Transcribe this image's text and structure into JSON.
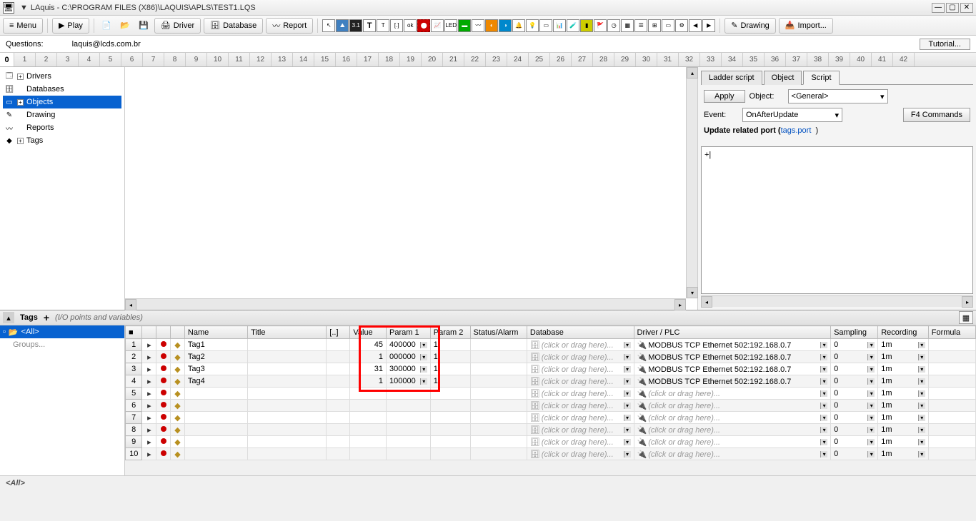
{
  "titlebar": {
    "app": "LAquis",
    "path": "C:\\PROGRAM FILES (X86)\\LAQUIS\\APLS\\TEST1.LQS"
  },
  "toolbar": {
    "menu": "Menu",
    "play": "Play",
    "driver": "Driver",
    "database": "Database",
    "report": "Report",
    "drawing": "Drawing",
    "import": "Import..."
  },
  "questions": {
    "label": "Questions:",
    "email": "laquis@lcds.com.br",
    "tutorial": "Tutorial..."
  },
  "ruler_start": "0",
  "tree": {
    "items": [
      "Drivers",
      "Databases",
      "Objects",
      "Drawing",
      "Reports",
      "Tags"
    ],
    "selected": "Objects"
  },
  "script_panel": {
    "tabs": [
      "Ladder script",
      "Object",
      "Script"
    ],
    "active_tab": "Script",
    "apply": "Apply",
    "object_label": "Object:",
    "object_value": "<General>",
    "event_label": "Event:",
    "event_value": "OnAfterUpdate",
    "f4": "F4 Commands",
    "update_text": "Update related port (",
    "tags_port": "tags.port",
    "close_paren": ")",
    "editor_content": "+|"
  },
  "tags_panel": {
    "title": "Tags",
    "hint": "(I/O points and variables)",
    "tree_all": "<All>",
    "tree_groups": "Groups...",
    "columns": [
      "",
      "",
      "",
      "",
      "Name",
      "Title",
      "[..]",
      "Value",
      "Param 1",
      "Param 2",
      "Status/Alarm",
      "Database",
      "Driver / PLC",
      "Sampling",
      "Recording",
      "Formula"
    ],
    "rows": [
      {
        "n": "1",
        "name": "Tag1",
        "value": "45",
        "p1": "400000",
        "p2": "1",
        "db": "(click or drag here)...",
        "drv": "MODBUS TCP Ethernet 502:192.168.0.7",
        "samp": "0",
        "rec": "1m"
      },
      {
        "n": "2",
        "name": "Tag2",
        "value": "1",
        "p1": "000000",
        "p2": "1",
        "db": "(click or drag here)...",
        "drv": "MODBUS TCP Ethernet 502:192.168.0.7",
        "samp": "0",
        "rec": "1m"
      },
      {
        "n": "3",
        "name": "Tag3",
        "value": "31",
        "p1": "300000",
        "p2": "1",
        "db": "(click or drag here)...",
        "drv": "MODBUS TCP Ethernet 502:192.168.0.7",
        "samp": "0",
        "rec": "1m"
      },
      {
        "n": "4",
        "name": "Tag4",
        "value": "1",
        "p1": "100000",
        "p2": "1",
        "db": "(click or drag here)...",
        "drv": "MODBUS TCP Ethernet 502:192.168.0.7",
        "samp": "0",
        "rec": "1m"
      },
      {
        "n": "5",
        "name": "",
        "value": "",
        "p1": "",
        "p2": "",
        "db": "(click or drag here)...",
        "drv": "(click or drag here)...",
        "samp": "0",
        "rec": "1m"
      },
      {
        "n": "6",
        "name": "",
        "value": "",
        "p1": "",
        "p2": "",
        "db": "(click or drag here)...",
        "drv": "(click or drag here)...",
        "samp": "0",
        "rec": "1m"
      },
      {
        "n": "7",
        "name": "",
        "value": "",
        "p1": "",
        "p2": "",
        "db": "(click or drag here)...",
        "drv": "(click or drag here)...",
        "samp": "0",
        "rec": "1m"
      },
      {
        "n": "8",
        "name": "",
        "value": "",
        "p1": "",
        "p2": "",
        "db": "(click or drag here)...",
        "drv": "(click or drag here)...",
        "samp": "0",
        "rec": "1m"
      },
      {
        "n": "9",
        "name": "",
        "value": "",
        "p1": "",
        "p2": "",
        "db": "(click or drag here)...",
        "drv": "(click or drag here)...",
        "samp": "0",
        "rec": "1m"
      },
      {
        "n": "10",
        "name": "",
        "value": "",
        "p1": "",
        "p2": "",
        "db": "(click or drag here)...",
        "drv": "(click or drag here)...",
        "samp": "0",
        "rec": "1m"
      }
    ]
  },
  "footer": {
    "all": "<All>"
  }
}
